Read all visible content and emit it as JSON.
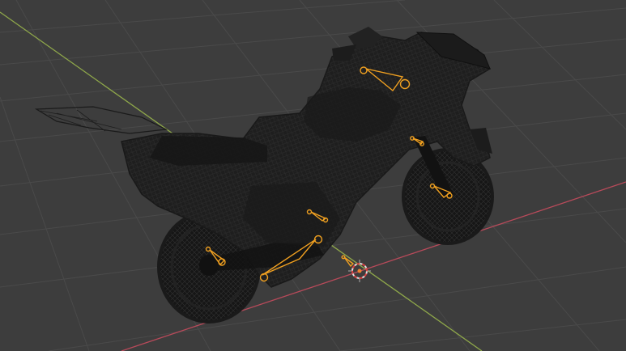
{
  "viewport": {
    "mode": "wireframe",
    "object": "motorcycle-wireframe",
    "armature_bone_count": 6,
    "colors": {
      "background": "#3d3d3d",
      "grid": "#4a4a4a",
      "axis_x": "#b84a5a",
      "axis_y": "#8fa84a",
      "wire": "#151515",
      "bone": "#f0a020",
      "cursor_red": "#d84040",
      "cursor_white": "#e0e0e0"
    }
  }
}
